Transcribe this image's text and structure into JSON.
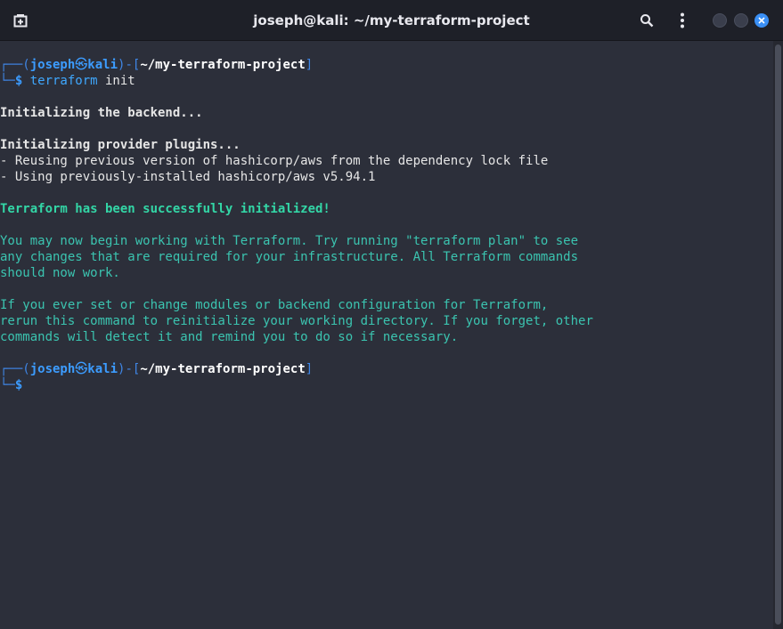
{
  "window": {
    "title": "joseph@kali: ~/my-terraform-project"
  },
  "icons": {
    "new_tab": "new-tab-icon",
    "search": "search-icon",
    "menu": "kebab-menu-icon",
    "close": "close-icon"
  },
  "prompt1": {
    "open": "┌──(",
    "user": "joseph",
    "at": "㉿",
    "host": "kali",
    "mid": ")-[",
    "path": "~/my-terraform-project",
    "close": "]",
    "corner": "└─",
    "dollar": "$ ",
    "command": "terraform",
    "args": " init"
  },
  "output": {
    "backend": "Initializing the backend...",
    "plugins": "Initializing provider plugins...",
    "reusing": "- Reusing previous version of hashicorp/aws from the dependency lock file",
    "using": "- Using previously-installed hashicorp/aws v5.94.1",
    "success": "Terraform has been successfully initialized!",
    "msg1_l1": "You may now begin working with Terraform. Try running \"terraform plan\" to see",
    "msg1_l2": "any changes that are required for your infrastructure. All Terraform commands",
    "msg1_l3": "should now work.",
    "msg2_l1": "If you ever set or change modules or backend configuration for Terraform,",
    "msg2_l2": "rerun this command to reinitialize your working directory. If you forget, other",
    "msg2_l3": "commands will detect it and remind you to do so if necessary."
  },
  "prompt2": {
    "open": "┌──(",
    "user": "joseph",
    "at": "㉿",
    "host": "kali",
    "mid": ")-[",
    "path": "~/my-terraform-project",
    "close": "]",
    "corner": "└─",
    "dollar": "$"
  },
  "colors": {
    "background": "#2c2f3a",
    "titlebar": "#1e2028",
    "prompt_blue": "#3c9cff",
    "success_green": "#33d6a6",
    "info_teal": "#3bc4b0",
    "close_button": "#3a8ff5"
  }
}
